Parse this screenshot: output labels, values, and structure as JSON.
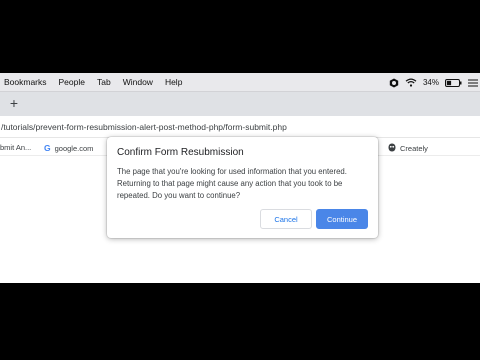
{
  "menubar": {
    "items": [
      "Bookmarks",
      "People",
      "Tab",
      "Window",
      "Help"
    ],
    "battery": "34%"
  },
  "tabstrip": {
    "new_tab_icon": "+"
  },
  "address": {
    "url": "/tutorials/prevent-form-resubmission-alert-post-method-php/form-submit.php"
  },
  "bookmarks": {
    "items": [
      {
        "label": "bmit An...",
        "icon": ""
      },
      {
        "label": "google.com",
        "icon": "G"
      },
      {
        "label": "Creately",
        "icon": "creately-icon"
      }
    ]
  },
  "dialog": {
    "title": "Confirm Form Resubmission",
    "body": "The page that you're looking for used information that you entered. Returning to that page might cause any action that you took to be repeated. Do you want to continue?",
    "cancel_label": "Cancel",
    "continue_label": "Continue"
  },
  "colors": {
    "accent": "#4a86e8",
    "menubar": "#e9e9ec",
    "tabstrip": "#dfe1e5"
  }
}
